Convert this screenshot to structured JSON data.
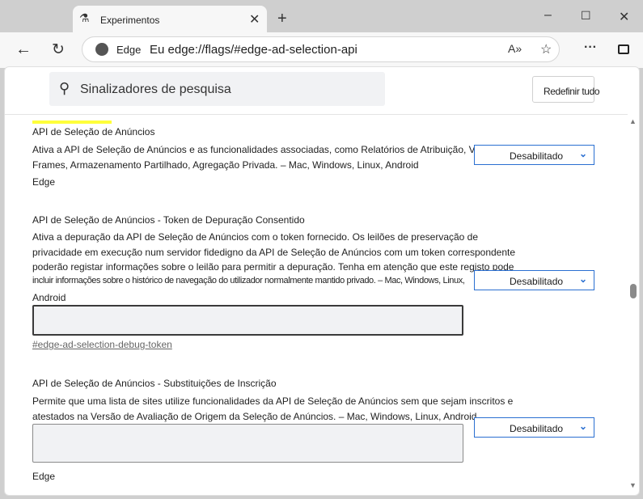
{
  "browser": {
    "tab_title": "Experimentos",
    "site_label": "Edge",
    "url": "Eu edge://flags/#edge-ad-selection-api"
  },
  "header": {
    "search_placeholder": "Sinalizadores de pesquisa",
    "reset_label": "Redefinir tudo"
  },
  "flags": [
    {
      "title": "API de Seleção de Anúncios",
      "desc": [
        "Ativa a API de Seleção de Anúncios e as funcionalidades associadas, como Relatórios de Atribuição, Vedado",
        "Frames, Armazenamento Partilhado, Agregação Privada. – Mac, Windows, Linux, Android"
      ],
      "extra": "Edge",
      "select": "Desabilitado"
    },
    {
      "title": "API de Seleção de Anúncios - Token de Depuração Consentido",
      "desc": [
        "Ativa a depuração da API de Seleção de Anúncios com o token fornecido. Os leilões de preservação de",
        "privacidade em execução num servidor fidedigno da API de Seleção de Anúncios com um token correspondente",
        "poderão registar informações sobre o leilão para permitir a depuração. Tenha em atenção que este registo pode",
        "incluir informações sobre o histórico de navegação do utilizador normalmente mantido privado. – Mac, Windows, Linux,"
      ],
      "extra": "Android",
      "select": "Desabilitado",
      "textarea_value": "",
      "link": "#edge-ad-selection-debug-token"
    },
    {
      "title": "API de Seleção de Anúncios - Substituições de Inscrição",
      "desc": [
        "Permite que uma lista de sites utilize funcionalidades da API de Seleção de Anúncios sem que sejam inscritos e",
        "atestados na Versão de Avaliação de Origem da Seleção de Anúncios. – Mac, Windows, Linux, Android"
      ],
      "extra": "Edge",
      "select": "Desabilitado",
      "textarea_value": ""
    }
  ],
  "colors": {
    "highlight": "#ffff3b",
    "select_border": "#2a6fd1"
  }
}
